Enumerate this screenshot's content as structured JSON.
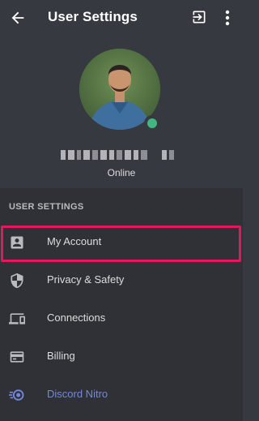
{
  "header": {
    "title": "User Settings",
    "back_icon": "arrow-left-icon",
    "logout_icon": "logout-icon",
    "more_icon": "more-vertical-icon"
  },
  "profile": {
    "status": "Online",
    "status_color": "#43b581"
  },
  "settings": {
    "section_title": "USER SETTINGS",
    "items": [
      {
        "label": "My Account",
        "icon": "account-card-icon"
      },
      {
        "label": "Privacy & Safety",
        "icon": "shield-icon"
      },
      {
        "label": "Connections",
        "icon": "devices-icon"
      },
      {
        "label": "Billing",
        "icon": "credit-card-icon"
      },
      {
        "label": "Discord Nitro",
        "icon": "nitro-icon"
      }
    ]
  },
  "colors": {
    "background": "#36393f",
    "panel": "#2f3136",
    "accent_nitro": "#7289da",
    "highlight": "#e8175d"
  }
}
